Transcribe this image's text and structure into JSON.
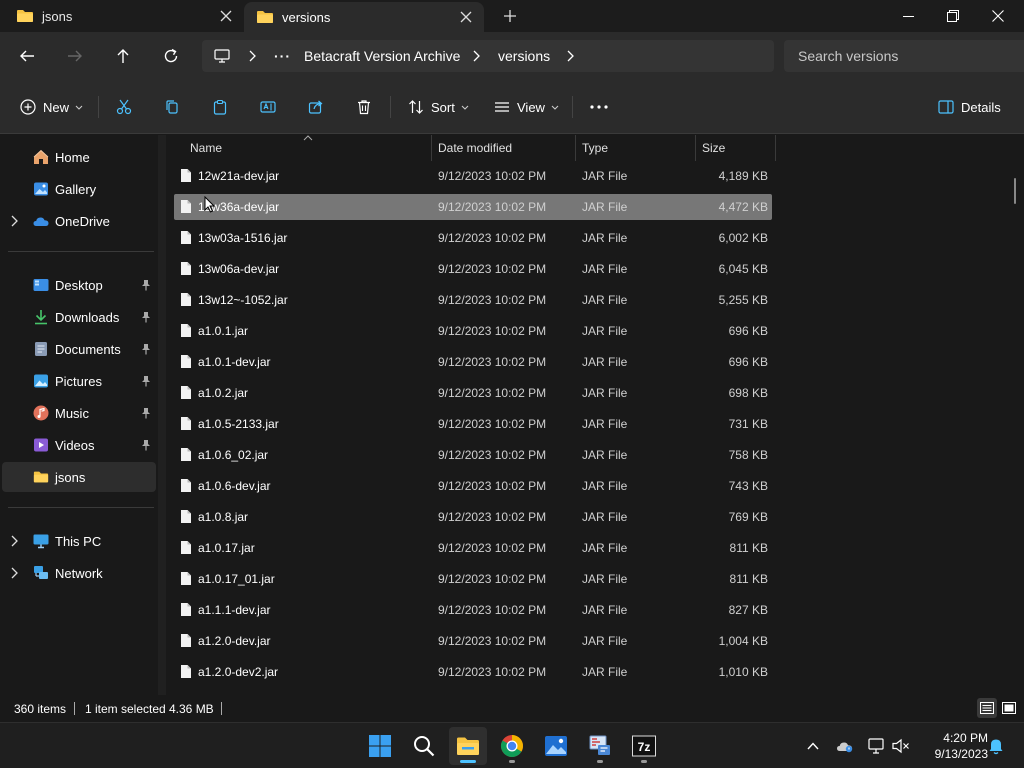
{
  "tabs": [
    {
      "label": "jsons",
      "active": false
    },
    {
      "label": "versions",
      "active": true
    }
  ],
  "address": {
    "ellipsis": "···",
    "crumbs": [
      "Betacraft Version Archive",
      "versions"
    ]
  },
  "search": {
    "placeholder": "Search versions"
  },
  "commands": {
    "new_label": "New",
    "sort_label": "Sort",
    "view_label": "View",
    "details_label": "Details"
  },
  "sidebar": {
    "quick": [
      {
        "label": "Home"
      },
      {
        "label": "Gallery"
      },
      {
        "label": "OneDrive"
      }
    ],
    "pinned": [
      {
        "label": "Desktop"
      },
      {
        "label": "Downloads"
      },
      {
        "label": "Documents"
      },
      {
        "label": "Pictures"
      },
      {
        "label": "Music"
      },
      {
        "label": "Videos"
      },
      {
        "label": "jsons"
      }
    ],
    "devices": [
      {
        "label": "This PC"
      },
      {
        "label": "Network"
      }
    ]
  },
  "columns": {
    "name": "Name",
    "date": "Date modified",
    "type": "Type",
    "size": "Size"
  },
  "files": [
    {
      "name": "12w21a-dev.jar",
      "date": "9/12/2023 10:02 PM",
      "type": "JAR File",
      "size": "4,189 KB"
    },
    {
      "name": "12w36a-dev.jar",
      "date": "9/12/2023 10:02 PM",
      "type": "JAR File",
      "size": "4,472 KB"
    },
    {
      "name": "13w03a-1516.jar",
      "date": "9/12/2023 10:02 PM",
      "type": "JAR File",
      "size": "6,002 KB"
    },
    {
      "name": "13w06a-dev.jar",
      "date": "9/12/2023 10:02 PM",
      "type": "JAR File",
      "size": "6,045 KB"
    },
    {
      "name": "13w12~-1052.jar",
      "date": "9/12/2023 10:02 PM",
      "type": "JAR File",
      "size": "5,255 KB"
    },
    {
      "name": "a1.0.1.jar",
      "date": "9/12/2023 10:02 PM",
      "type": "JAR File",
      "size": "696 KB"
    },
    {
      "name": "a1.0.1-dev.jar",
      "date": "9/12/2023 10:02 PM",
      "type": "JAR File",
      "size": "696 KB"
    },
    {
      "name": "a1.0.2.jar",
      "date": "9/12/2023 10:02 PM",
      "type": "JAR File",
      "size": "698 KB"
    },
    {
      "name": "a1.0.5-2133.jar",
      "date": "9/12/2023 10:02 PM",
      "type": "JAR File",
      "size": "731 KB"
    },
    {
      "name": "a1.0.6_02.jar",
      "date": "9/12/2023 10:02 PM",
      "type": "JAR File",
      "size": "758 KB"
    },
    {
      "name": "a1.0.6-dev.jar",
      "date": "9/12/2023 10:02 PM",
      "type": "JAR File",
      "size": "743 KB"
    },
    {
      "name": "a1.0.8.jar",
      "date": "9/12/2023 10:02 PM",
      "type": "JAR File",
      "size": "769 KB"
    },
    {
      "name": "a1.0.17.jar",
      "date": "9/12/2023 10:02 PM",
      "type": "JAR File",
      "size": "811 KB"
    },
    {
      "name": "a1.0.17_01.jar",
      "date": "9/12/2023 10:02 PM",
      "type": "JAR File",
      "size": "811 KB"
    },
    {
      "name": "a1.1.1-dev.jar",
      "date": "9/12/2023 10:02 PM",
      "type": "JAR File",
      "size": "827 KB"
    },
    {
      "name": "a1.2.0-dev.jar",
      "date": "9/12/2023 10:02 PM",
      "type": "JAR File",
      "size": "1,004 KB"
    },
    {
      "name": "a1.2.0-dev2.jar",
      "date": "9/12/2023 10:02 PM",
      "type": "JAR File",
      "size": "1,010 KB"
    }
  ],
  "selected_index": 1,
  "status": {
    "items": "360 items",
    "selected": "1 item selected",
    "size": "4.36 MB"
  },
  "clock": {
    "time": "4:20 PM",
    "date": "9/13/2023"
  },
  "colors": {
    "accent": "#4cc2ff",
    "folder": "#f5c342",
    "selection": "#777777",
    "onedrive": "#3a8ee6"
  }
}
